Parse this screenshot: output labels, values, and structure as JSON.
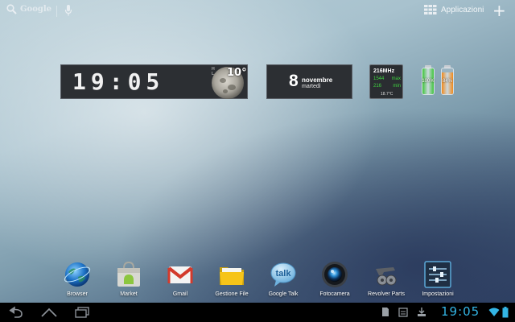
{
  "top_bar": {
    "search_label": "Google",
    "apps_label": "Applicazioni",
    "add_label": "+"
  },
  "clock_widget": {
    "time": "19:05",
    "temperature": "10°",
    "hl": "H\nL"
  },
  "date_widget": {
    "day": "8",
    "month": "novembre",
    "weekday": "martedì"
  },
  "cpu_widget": {
    "frequency": "216MHz",
    "max_value": "1544",
    "max_label": "max",
    "min_value": "216",
    "min_label": "min",
    "temperature": "18.7°C"
  },
  "batteries": [
    {
      "label": "100%",
      "level": 1.0,
      "color": "#3ec43a"
    },
    {
      "label": "84%",
      "level": 0.84,
      "color": "#f08a1c"
    }
  ],
  "dock": [
    {
      "label": "Browser",
      "icon": "globe-icon"
    },
    {
      "label": "Market",
      "icon": "market-bag-icon"
    },
    {
      "label": "Gmail",
      "icon": "gmail-icon"
    },
    {
      "label": "Gestione File",
      "icon": "folder-icon"
    },
    {
      "label": "Google Talk",
      "icon": "talk-bubble-icon"
    },
    {
      "label": "Fotocamera",
      "icon": "camera-lens-icon"
    },
    {
      "label": "Revolver Parts",
      "icon": "revolver-icon"
    },
    {
      "label": "Impostazioni",
      "icon": "settings-sliders-icon"
    }
  ],
  "system_bar": {
    "time": "19:05",
    "accent_color": "#33b5e5"
  }
}
